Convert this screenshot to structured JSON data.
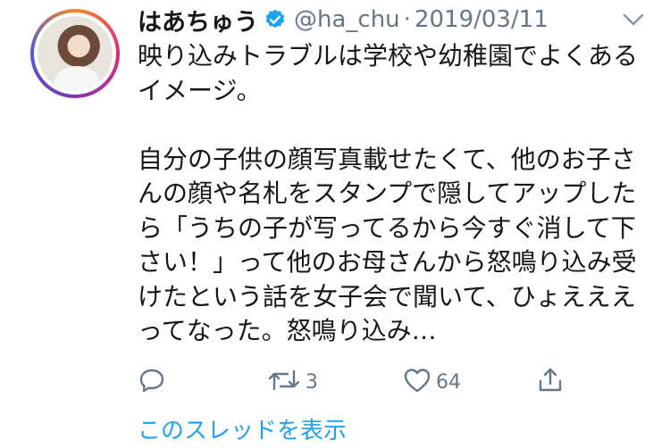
{
  "tweet": {
    "display_name": "はあちゅう",
    "handle": "@ha_chu",
    "separator": "·",
    "date": "2019/03/11",
    "text": "映り込みトラブルは学校や幼稚園でよくある\nイメージ。\n\n自分の子供の顔写真載せたくて、他のお子さ\nんの顔や名札をスタンプで隠してアップした\nら「うちの子が写ってるから今すぐ消して下\nさい！」って他のお母さんから怒鳴り込み受\nけたという話を女子会で聞いて、ひょえええ\nってなった。怒鳴り込み…",
    "actions": {
      "reply_icon": "reply-icon",
      "retweet_icon": "retweet-icon",
      "retweet_count": "3",
      "like_icon": "heart-icon",
      "like_count": "64",
      "share_icon": "share-icon"
    },
    "thread_link": "このスレッドを表示"
  },
  "colors": {
    "text": "#14171a",
    "secondary": "#657786",
    "accent": "#1da1f2",
    "verified": "#1da1f2"
  }
}
